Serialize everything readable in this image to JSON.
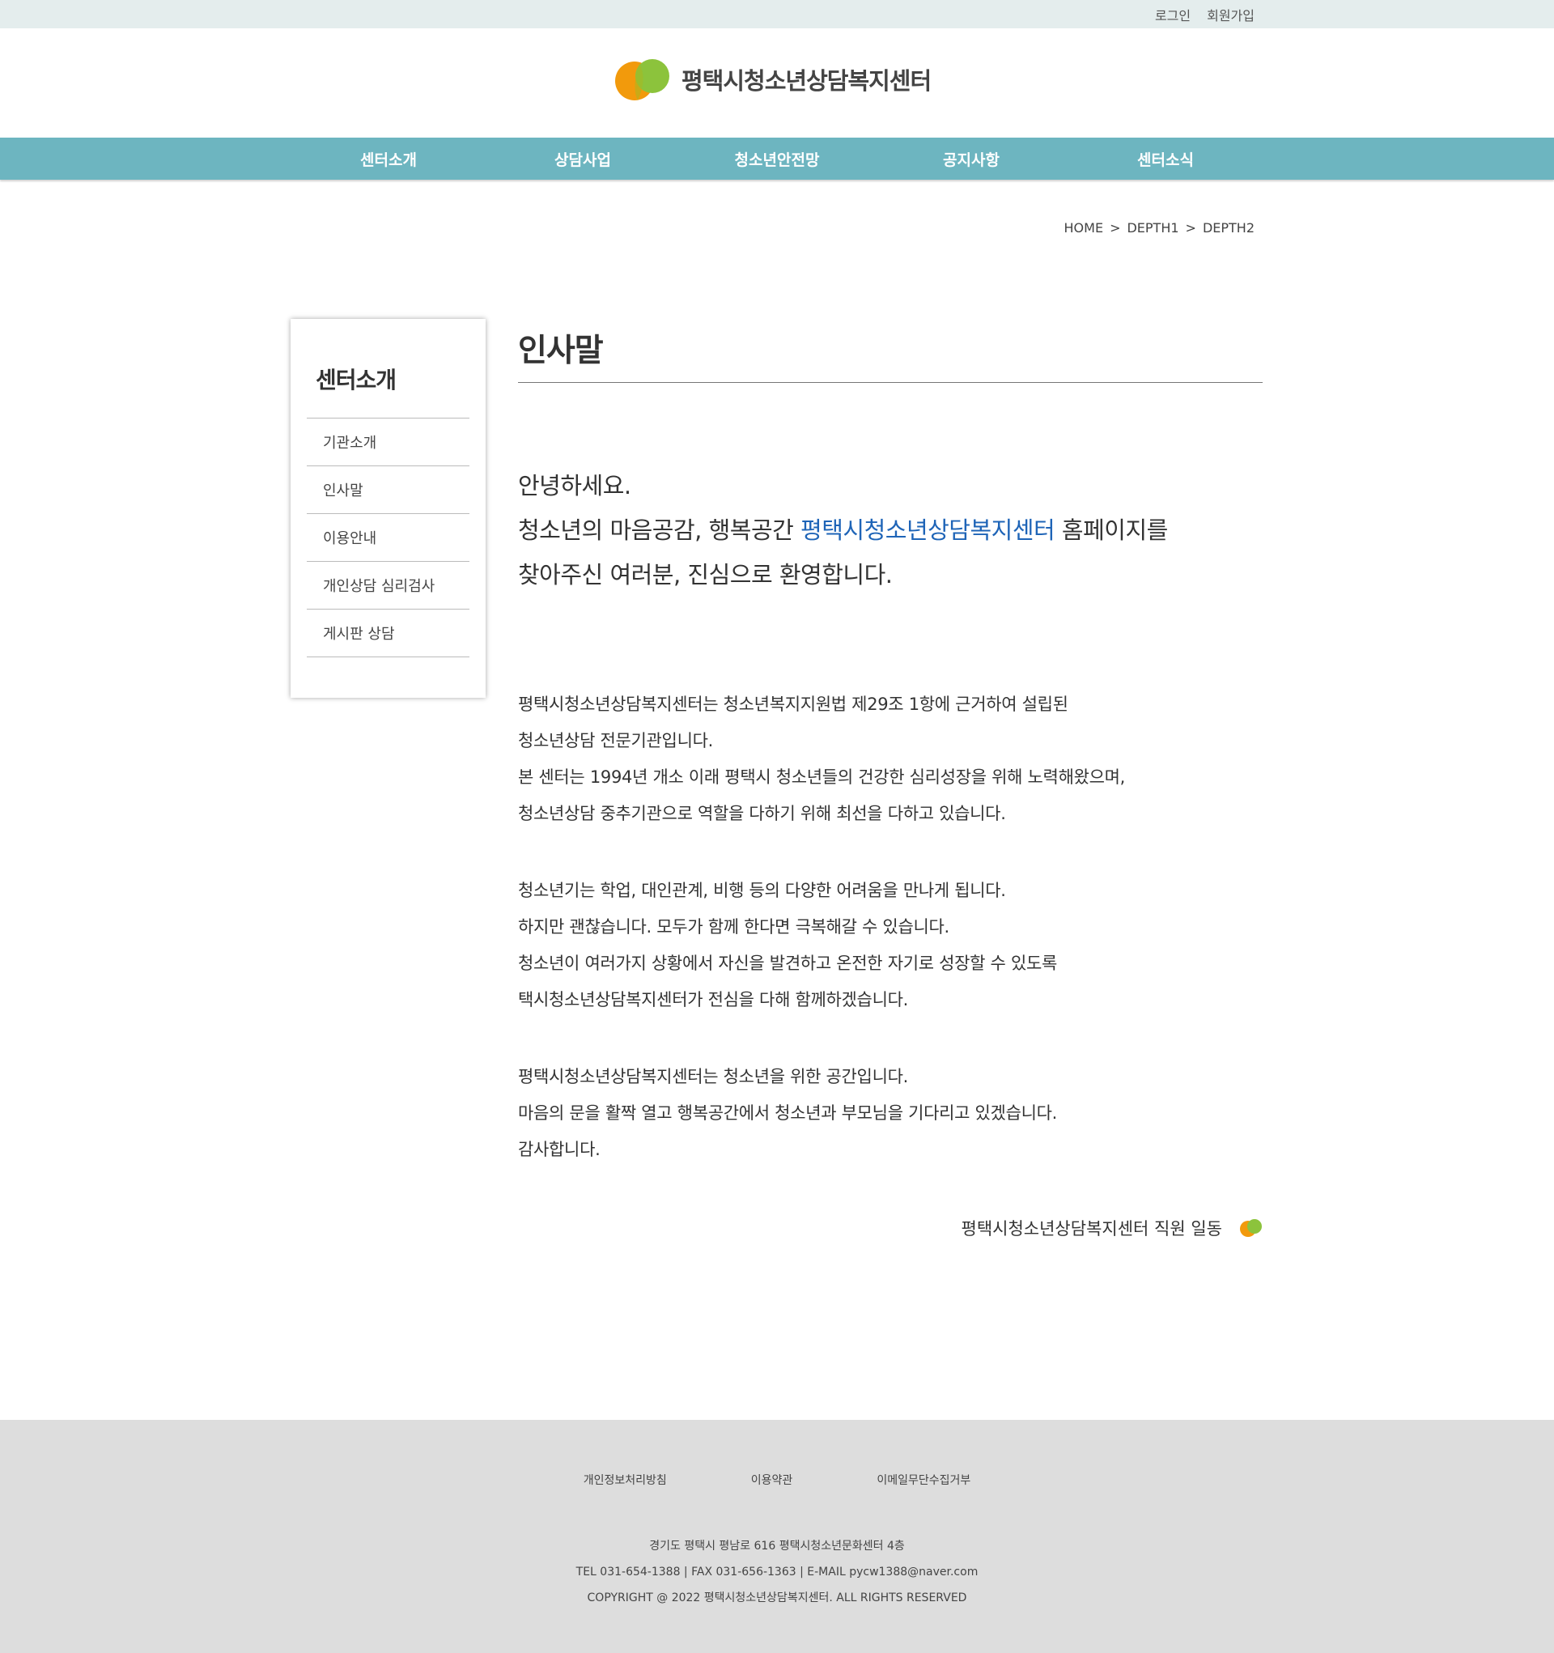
{
  "topbar": {
    "login": "로그인",
    "signup": "회원가입"
  },
  "logo": {
    "name": "평택시청소년상담복지센터"
  },
  "colors": {
    "nav_bg": "#6db5c0",
    "accent_blue": "#1e64b7",
    "logo_orange": "#f29a0c",
    "logo_green": "#8cc33c"
  },
  "nav": [
    "센터소개",
    "상담사업",
    "청소년안전망",
    "공지사항",
    "센터소식"
  ],
  "breadcrumb": {
    "home": "HOME",
    "sep": ">",
    "depth1": "DEPTH1",
    "depth2": "DEPTH2"
  },
  "sidebar": {
    "title": "센터소개",
    "items": [
      "기관소개",
      "인사말",
      "이용안내",
      "개인상담 심리검사",
      "게시판 상담"
    ]
  },
  "content": {
    "title": "인사말",
    "greeting": {
      "line1": "안녕하세요.",
      "line2_prefix": "청소년의 마음공감, 행복공간 ",
      "line2_highlight": "평택시청소년상담복지센터",
      "line2_suffix": " 홈페이지를",
      "line3": "찾아주신 여러분, 진심으로 환영합니다."
    },
    "para1": [
      "평택시청소년상담복지센터는 청소년복지지원법 제29조 1항에 근거하여 설립된",
      "청소년상담 전문기관입니다.",
      "본 센터는 1994년 개소 이래 평택시 청소년들의 건강한 심리성장을 위해 노력해왔으며,",
      "청소년상담 중추기관으로 역할을 다하기 위해 최선을 다하고 있습니다."
    ],
    "para2": [
      "청소년기는 학업, 대인관계, 비행 등의 다양한 어려움을 만나게 됩니다.",
      "하지만 괜찮습니다. 모두가 함께 한다면 극복해갈 수 있습니다.",
      "청소년이 여러가지 상황에서 자신을 발견하고 온전한 자기로 성장할 수 있도록",
      "택시청소년상담복지센터가 전심을 다해 함께하겠습니다."
    ],
    "para3": [
      "평택시청소년상담복지센터는 청소년을 위한 공간입니다.",
      "마음의 문을 활짝 열고 행복공간에서 청소년과 부모님을 기다리고 있겠습니다.",
      "감사합니다."
    ],
    "signature": "평택시청소년상담복지센터 직원 일동"
  },
  "footer": {
    "links": [
      "개인정보처리방침",
      "이용약관",
      "이메일무단수집거부"
    ],
    "address": "경기도 평택시 평남로 616 평택시청소년문화센터 4층",
    "contact": "TEL 031-654-1388 | FAX 031-656-1363 | E-MAIL pycw1388@naver.com",
    "copyright": "COPYRIGHT @ 2022 평택시청소년상담복지센터. ALL RIGHTS RESERVED"
  }
}
